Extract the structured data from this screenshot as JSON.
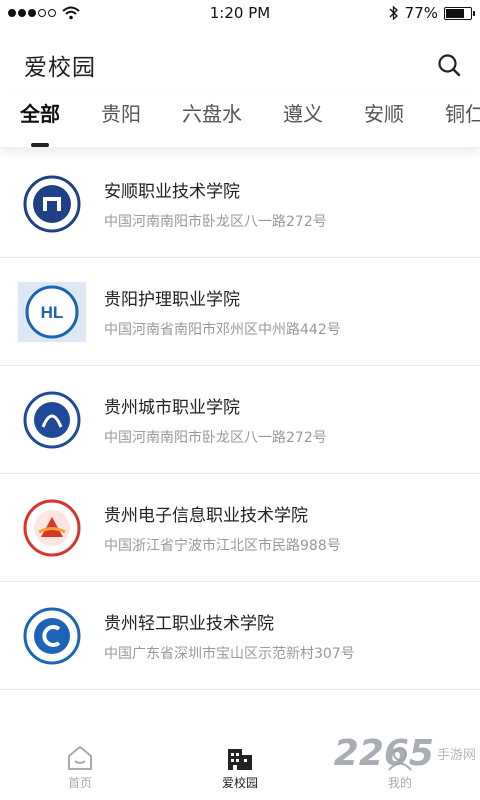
{
  "status_bar": {
    "time": "1:20 PM",
    "battery": "77%",
    "battery_level": 0.77
  },
  "header": {
    "title": "爱校园"
  },
  "tabs": [
    {
      "label": "全部",
      "active": true
    },
    {
      "label": "贵阳",
      "active": false
    },
    {
      "label": "六盘水",
      "active": false
    },
    {
      "label": "遵义",
      "active": false
    },
    {
      "label": "安顺",
      "active": false
    },
    {
      "label": "铜仁",
      "active": false
    }
  ],
  "schools": [
    {
      "name": "安顺职业技术学院",
      "address": "中国河南南阳市卧龙区八一路272号",
      "logo_color": "#1f3f86"
    },
    {
      "name": "贵阳护理职业学院",
      "address": "中国河南省南阳市邓州区中州路442号",
      "logo_color": "#1b63b3"
    },
    {
      "name": "贵州城市职业学院",
      "address": "中国河南南阳市卧龙区八一路272号",
      "logo_color": "#1f4a9a"
    },
    {
      "name": "贵州电子信息职业技术学院",
      "address": "中国浙江省宁波市江北区市民路988号",
      "logo_color": "#d8352c"
    },
    {
      "name": "贵州轻工职业技术学院",
      "address": "中国广东省深圳市宝山区示范新村307号",
      "logo_color": "#1d63b8"
    }
  ],
  "bottom_nav": [
    {
      "label": "首页",
      "icon": "home-icon",
      "active": false
    },
    {
      "label": "爱校园",
      "icon": "campus-icon",
      "active": true
    },
    {
      "label": "我的",
      "icon": "user-icon",
      "active": false
    }
  ],
  "watermark": {
    "number": "2265",
    "text": "手游网"
  }
}
